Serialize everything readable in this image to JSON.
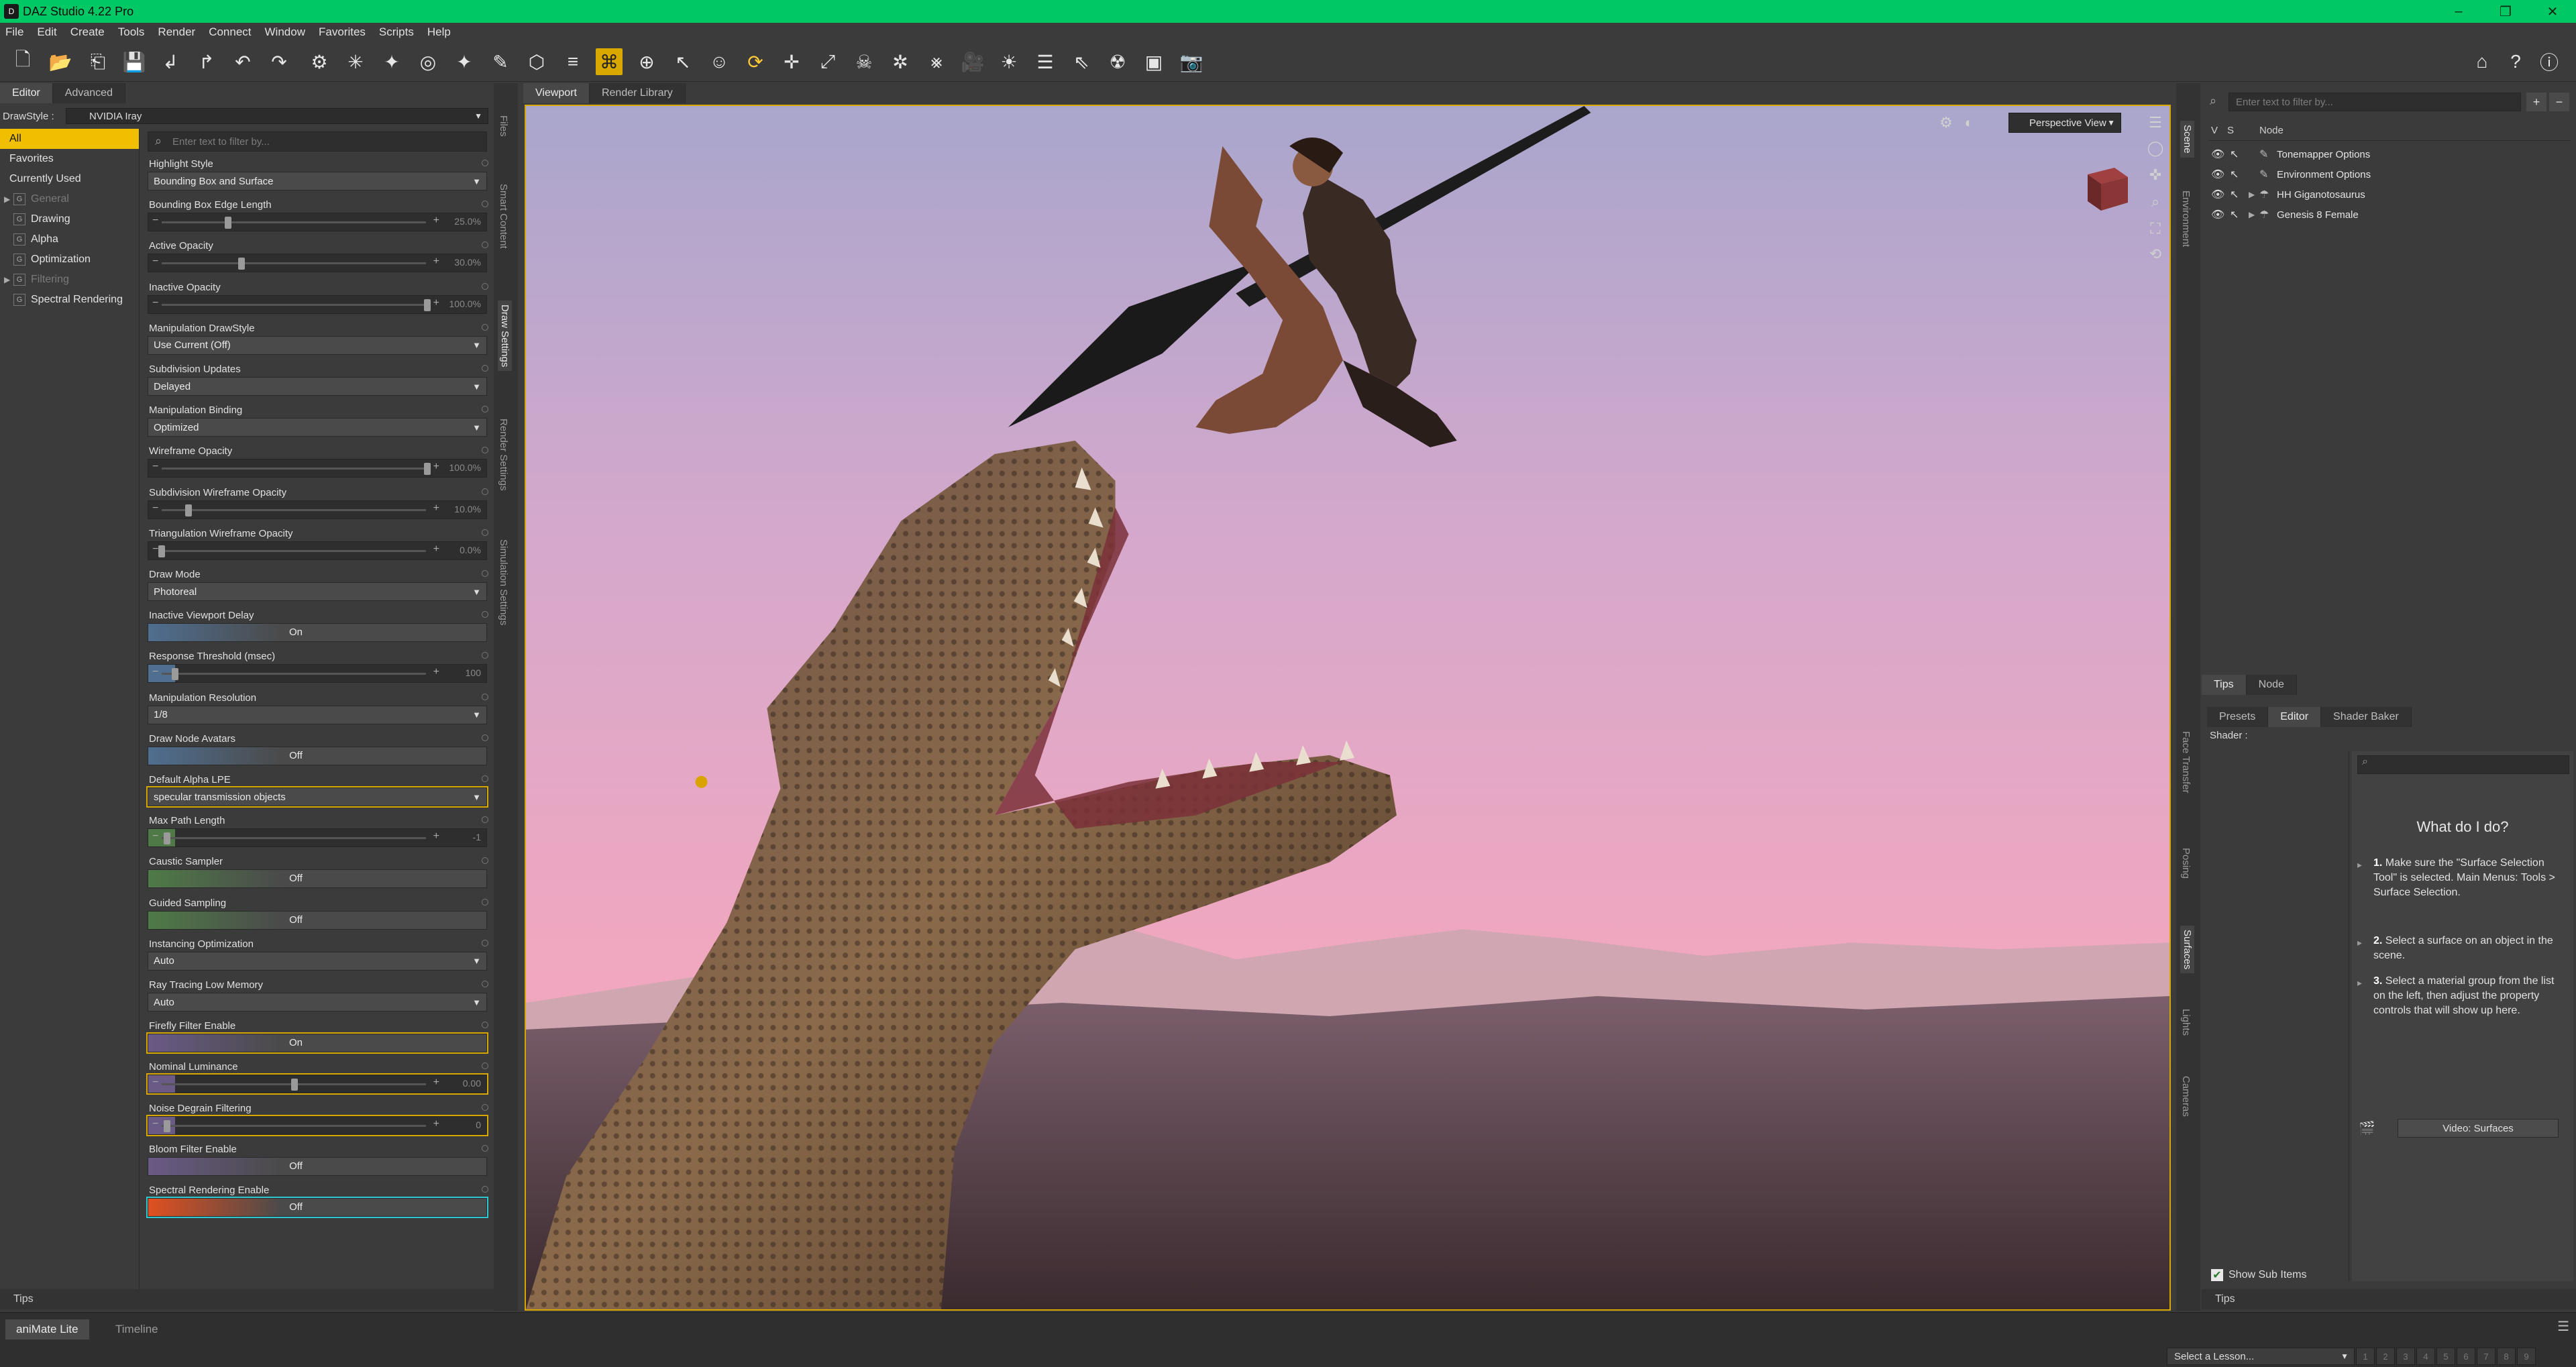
{
  "app": {
    "title": "DAZ Studio 4.22 Pro",
    "accent": "#00c864",
    "highlight": "#f0c000"
  },
  "menu": [
    "File",
    "Edit",
    "Create",
    "Tools",
    "Render",
    "Connect",
    "Window",
    "Favorites",
    "Scripts",
    "Help"
  ],
  "left_pane": {
    "tabs": [
      "Editor",
      "Advanced"
    ],
    "drawstyle_label": "DrawStyle :",
    "drawstyle_value": "NVIDIA Iray",
    "filter_placeholder": "Enter text to filter by...",
    "groups": [
      {
        "label": "All",
        "selected": true
      },
      {
        "label": "Favorites"
      },
      {
        "label": "Currently Used"
      },
      {
        "label": "General",
        "dim": true,
        "icon": true,
        "expandable": true
      },
      {
        "label": "Drawing",
        "icon": true
      },
      {
        "label": "Alpha",
        "icon": true
      },
      {
        "label": "Optimization",
        "icon": true
      },
      {
        "label": "Filtering",
        "dim": true,
        "icon": true,
        "expandable": true
      },
      {
        "label": "Spectral Rendering",
        "icon": true
      }
    ],
    "show_sub_items": "Show Sub Items",
    "properties": [
      {
        "label": "Highlight Style",
        "kind": "dropdown",
        "value": "Bounding Box and Surface"
      },
      {
        "label": "Bounding Box Edge Length",
        "kind": "slider",
        "value": "25.0%",
        "level": 0.25
      },
      {
        "label": "Active Opacity",
        "kind": "slider",
        "value": "30.0%",
        "level": 0.3
      },
      {
        "label": "Inactive Opacity",
        "kind": "slider",
        "value": "100.0%",
        "level": 1.0
      },
      {
        "label": "Manipulation DrawStyle",
        "kind": "dropdown",
        "value": "Use Current (Off)"
      },
      {
        "label": "Subdivision Updates",
        "kind": "dropdown",
        "value": "Delayed"
      },
      {
        "label": "Manipulation Binding",
        "kind": "dropdown",
        "value": "Optimized"
      },
      {
        "label": "Wireframe Opacity",
        "kind": "slider",
        "value": "100.0%",
        "level": 1.0
      },
      {
        "label": "Subdivision Wireframe Opacity",
        "kind": "slider",
        "value": "10.0%",
        "level": 0.1
      },
      {
        "label": "Triangulation Wireframe Opacity",
        "kind": "slider",
        "value": "0.0%",
        "level": 0.0
      },
      {
        "label": "Draw Mode",
        "kind": "dropdown",
        "value": "Photoreal"
      },
      {
        "label": "Inactive Viewport Delay",
        "kind": "toggle",
        "value": "On",
        "grad": "blue"
      },
      {
        "label": "Response Threshold (msec)",
        "kind": "slider",
        "value": "100",
        "level": 0.05,
        "grad": "blue"
      },
      {
        "label": "Manipulation Resolution",
        "kind": "dropdown",
        "value": "1/8"
      },
      {
        "label": "Draw Node Avatars",
        "kind": "toggle",
        "value": "Off",
        "grad": "blue"
      },
      {
        "label": "Default Alpha LPE",
        "kind": "dropdown",
        "value": "specular transmission objects",
        "hl": "gold"
      },
      {
        "label": "Max Path Length",
        "kind": "slider",
        "value": "-1",
        "level": 0.02,
        "grad": "green"
      },
      {
        "label": "Caustic Sampler",
        "kind": "toggle",
        "value": "Off",
        "grad": "green"
      },
      {
        "label": "Guided Sampling",
        "kind": "toggle",
        "value": "Off",
        "grad": "green"
      },
      {
        "label": "Instancing Optimization",
        "kind": "dropdown",
        "value": "Auto"
      },
      {
        "label": "Ray Tracing Low Memory",
        "kind": "dropdown",
        "value": "Auto"
      },
      {
        "label": "Firefly Filter Enable",
        "kind": "toggle",
        "value": "On",
        "grad": "purple",
        "hl": "gold"
      },
      {
        "label": "Nominal Luminance",
        "kind": "slider",
        "value": "0.00",
        "level": 0.5,
        "grad": "purple",
        "hl": "gold"
      },
      {
        "label": "Noise Degrain Filtering",
        "kind": "slider",
        "value": "0",
        "level": 0.02,
        "grad": "purple",
        "hl": "gold"
      },
      {
        "label": "Bloom Filter Enable",
        "kind": "toggle",
        "value": "Off",
        "grad": "purple"
      },
      {
        "label": "Spectral Rendering Enable",
        "kind": "toggle",
        "value": "Off",
        "grad": "orange",
        "hl": "cyan"
      }
    ],
    "vertical_tabs": [
      "Files",
      "Smart Content",
      "Draw Settings",
      "Render Settings",
      "Simulation Settings"
    ]
  },
  "viewport": {
    "tabs": [
      "Viewport",
      "Render Library"
    ],
    "view": "Perspective View"
  },
  "right_pane": {
    "vertical_tabs_top": [
      "Scene",
      "Environment"
    ],
    "vertical_tabs_bottom": [
      "Face Transfer",
      "Posing",
      "Surfaces",
      "Lights",
      "Cameras"
    ],
    "filter_placeholder": "Enter text to filter by...",
    "header": {
      "v": "V",
      "s": "S",
      "node": "Node"
    },
    "nodes": [
      {
        "label": "Tonemapper Options",
        "expandable": false
      },
      {
        "label": "Environment Options",
        "expandable": false
      },
      {
        "label": "HH Giganotosaurus",
        "expandable": true
      },
      {
        "label": "Genesis 8 Female",
        "expandable": true
      }
    ],
    "mid_tabs": [
      "Tips",
      "Node"
    ],
    "surface_tabs": [
      "Presets",
      "Editor",
      "Shader Baker"
    ],
    "shader_label": "Shader :",
    "help_title": "What do I do?",
    "steps": [
      {
        "num": "1.",
        "text": "Make sure the \"Surface Selection Tool\" is selected. Main Menus: Tools > Surface Selection."
      },
      {
        "num": "2.",
        "text": "Select a surface on an object in the scene."
      },
      {
        "num": "3.",
        "text": "Select a material group from the list on the left, then adjust the property controls that will show up here."
      }
    ],
    "video_button": "Video: Surfaces",
    "show_sub_items": "Show Sub Items"
  },
  "bottom": {
    "left_tips": "Tips",
    "right_tips": "Tips",
    "tabs": [
      "aniMate Lite",
      "Timeline"
    ],
    "lesson_placeholder": "Select a Lesson...",
    "lesson_numbers": [
      "1",
      "2",
      "3",
      "4",
      "5",
      "6",
      "7",
      "8",
      "9"
    ]
  }
}
